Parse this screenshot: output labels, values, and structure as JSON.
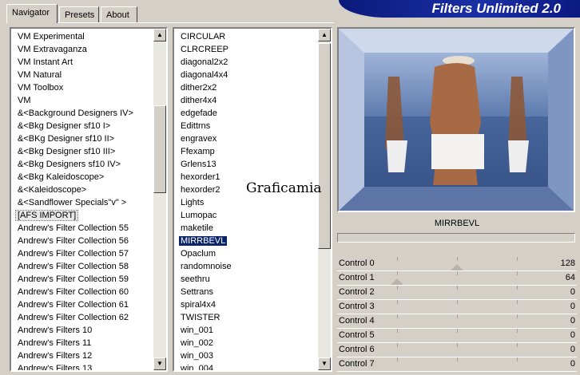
{
  "tabs": [
    {
      "label": "Navigator",
      "active": true
    },
    {
      "label": "Presets",
      "active": false
    },
    {
      "label": "About",
      "active": false
    }
  ],
  "banner": {
    "title": "Filters Unlimited 2.0"
  },
  "categories": [
    {
      "label": "VM Experimental"
    },
    {
      "label": "VM Extravaganza"
    },
    {
      "label": "VM Instant Art"
    },
    {
      "label": "VM Natural"
    },
    {
      "label": "VM Toolbox"
    },
    {
      "label": "VM"
    },
    {
      "label": "&<Background Designers IV>"
    },
    {
      "label": "&<Bkg Designer sf10 I>"
    },
    {
      "label": "&<BKg Designer sf10 II>"
    },
    {
      "label": "&<Bkg Designer sf10 III>"
    },
    {
      "label": "&<Bkg Designers sf10 IV>"
    },
    {
      "label": "&<Bkg Kaleidoscope>"
    },
    {
      "label": "&<Kaleidoscope>"
    },
    {
      "label": "&<Sandflower Specials\"v\" >"
    },
    {
      "label": "[AFS IMPORT]",
      "state": "focused"
    },
    {
      "label": "Andrew's Filter Collection 55"
    },
    {
      "label": "Andrew's Filter Collection 56"
    },
    {
      "label": "Andrew's Filter Collection 57"
    },
    {
      "label": "Andrew's Filter Collection 58"
    },
    {
      "label": "Andrew's Filter Collection 59"
    },
    {
      "label": "Andrew's Filter Collection 60"
    },
    {
      "label": "Andrew's Filter Collection 61"
    },
    {
      "label": "Andrew's Filter Collection 62"
    },
    {
      "label": "Andrew's Filters 10"
    },
    {
      "label": "Andrew's Filters 11"
    },
    {
      "label": "Andrew's Filters 12"
    },
    {
      "label": "Andrew's Filters 13"
    }
  ],
  "filters": [
    {
      "label": "CIRCULAR"
    },
    {
      "label": "CLRCREEP"
    },
    {
      "label": "diagonal2x2"
    },
    {
      "label": "diagonal4x4"
    },
    {
      "label": "dither2x2"
    },
    {
      "label": "dither4x4"
    },
    {
      "label": "edgefade"
    },
    {
      "label": "Edittrns"
    },
    {
      "label": "engravex"
    },
    {
      "label": "Ffexamp"
    },
    {
      "label": "Grlens13"
    },
    {
      "label": "hexorder1"
    },
    {
      "label": "hexorder2"
    },
    {
      "label": "Lights"
    },
    {
      "label": "Lumopac"
    },
    {
      "label": "maketile"
    },
    {
      "label": "MIRRBEVL",
      "state": "selected"
    },
    {
      "label": "Opaclum"
    },
    {
      "label": "randomnoise"
    },
    {
      "label": "seethru"
    },
    {
      "label": "Settrans"
    },
    {
      "label": "spiral4x4"
    },
    {
      "label": "TWISTER"
    },
    {
      "label": "win_001"
    },
    {
      "label": "win_002"
    },
    {
      "label": "win_003"
    },
    {
      "label": "win_004"
    }
  ],
  "preview": {
    "watermark": "Graficamia"
  },
  "selected_filter": "MIRRBEVL",
  "controls": [
    {
      "label": "Control 0",
      "value": "128",
      "level": 0.5
    },
    {
      "label": "Control 1",
      "value": "64",
      "level": 0.25
    },
    {
      "label": "Control 2",
      "value": "0",
      "level": 0
    },
    {
      "label": "Control 3",
      "value": "0",
      "level": 0
    },
    {
      "label": "Control 4",
      "value": "0",
      "level": 0
    },
    {
      "label": "Control 5",
      "value": "0",
      "level": 0
    },
    {
      "label": "Control 6",
      "value": "0",
      "level": 0
    },
    {
      "label": "Control 7",
      "value": "0",
      "level": 0
    }
  ],
  "icons": {
    "scroll_up": "arrow-up-icon",
    "scroll_down": "arrow-down-icon"
  }
}
